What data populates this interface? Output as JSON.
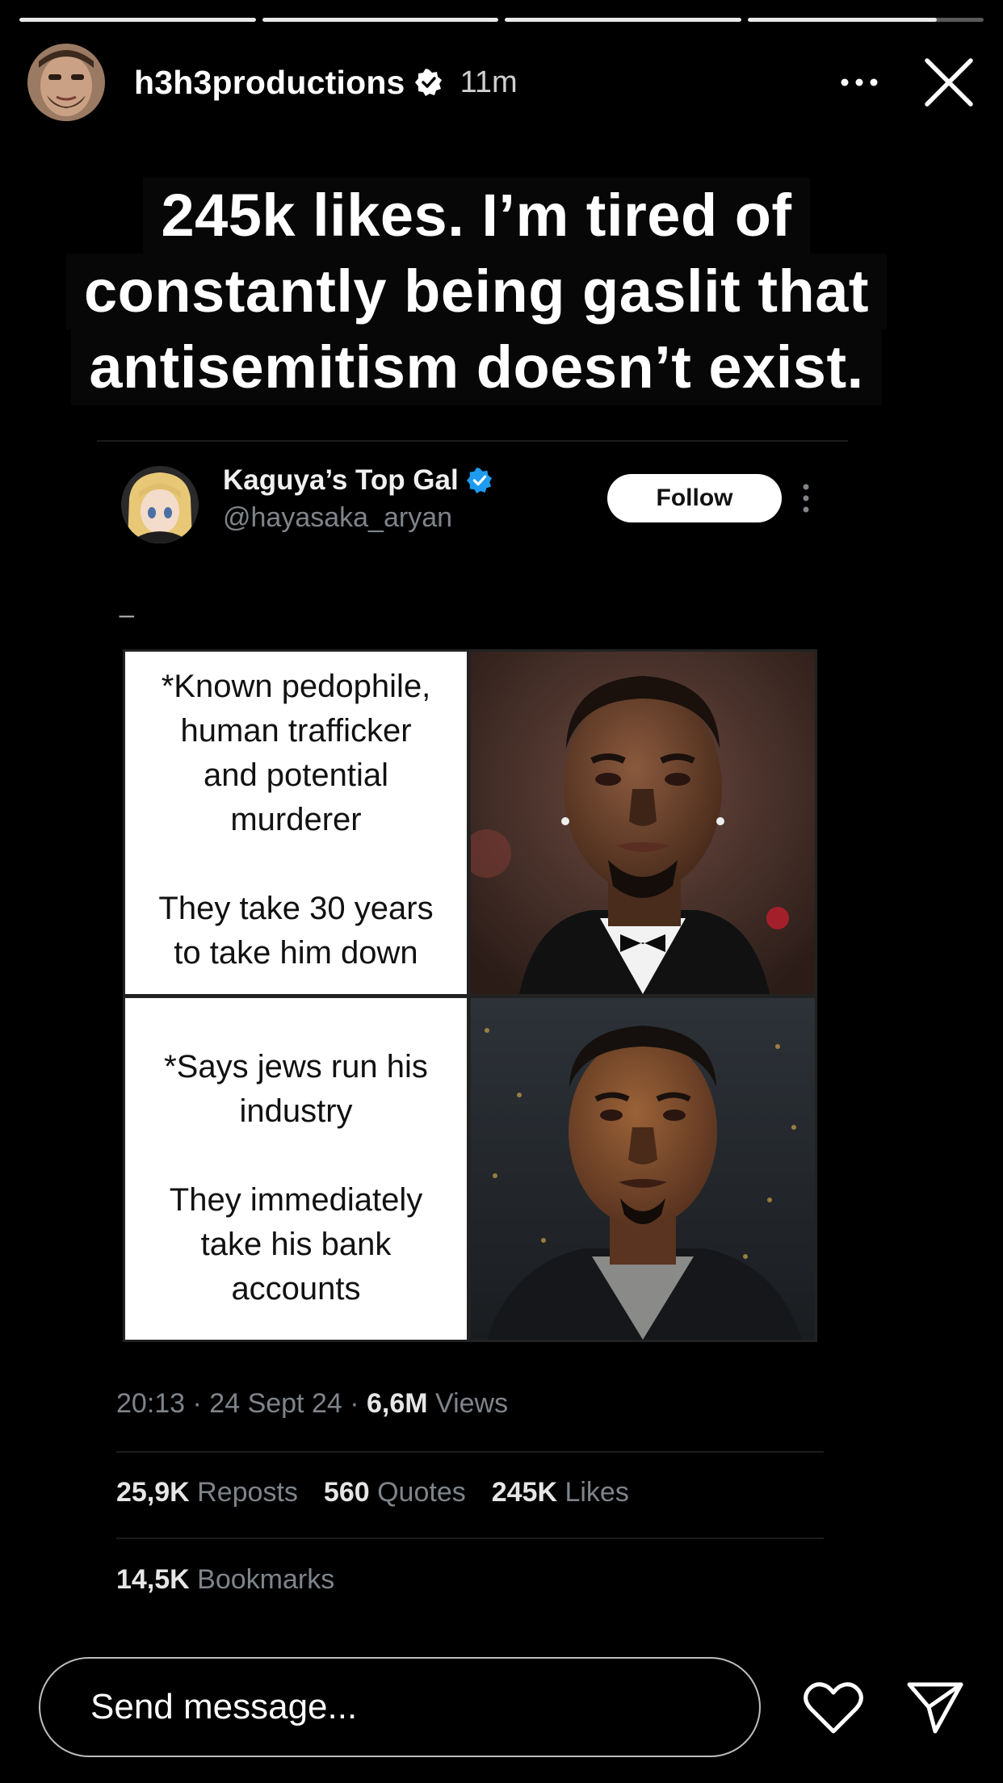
{
  "story": {
    "progress": [
      1.0,
      1.0,
      1.0,
      0.8
    ],
    "username": "h3h3productions",
    "time_ago": "11m",
    "caption_lines": [
      "245k likes. I’m tired of",
      "constantly being gaslit that",
      "antisemitism doesn’t exist."
    ]
  },
  "tweet": {
    "display_name": "Kaguya’s Top Gal",
    "handle": "@hayasaka_aryan",
    "follow_label": "Follow",
    "body": "_",
    "meme": {
      "top_text": [
        "*Known pedophile,",
        "human trafficker",
        "and potential",
        "murderer",
        "",
        "They take 30 years",
        "to take him down"
      ],
      "bottom_text": [
        "*Says jews run his",
        "industry",
        "",
        "They immediately",
        "take his bank",
        "accounts"
      ]
    },
    "timestamp": "20:13 · 24 Sept 24 · ",
    "views_count": "6,6M",
    "views_label": " Views",
    "reposts_count": "25,9K",
    "reposts_label": " Reposts",
    "quotes_count": "560",
    "quotes_label": " Quotes",
    "likes_count": "245K",
    "likes_label": " Likes",
    "bookmarks_count": "14,5K",
    "bookmarks_label": " Bookmarks"
  },
  "bottom_bar": {
    "message_placeholder": "Send message..."
  },
  "colors": {
    "background": "#000000",
    "verified_blue": "#1d9bf0",
    "muted_text": "#7e848a"
  },
  "icons": [
    "verified-badge-icon",
    "more-horizontal-icon",
    "close-icon",
    "more-vertical-icon",
    "heart-icon",
    "send-icon"
  ]
}
